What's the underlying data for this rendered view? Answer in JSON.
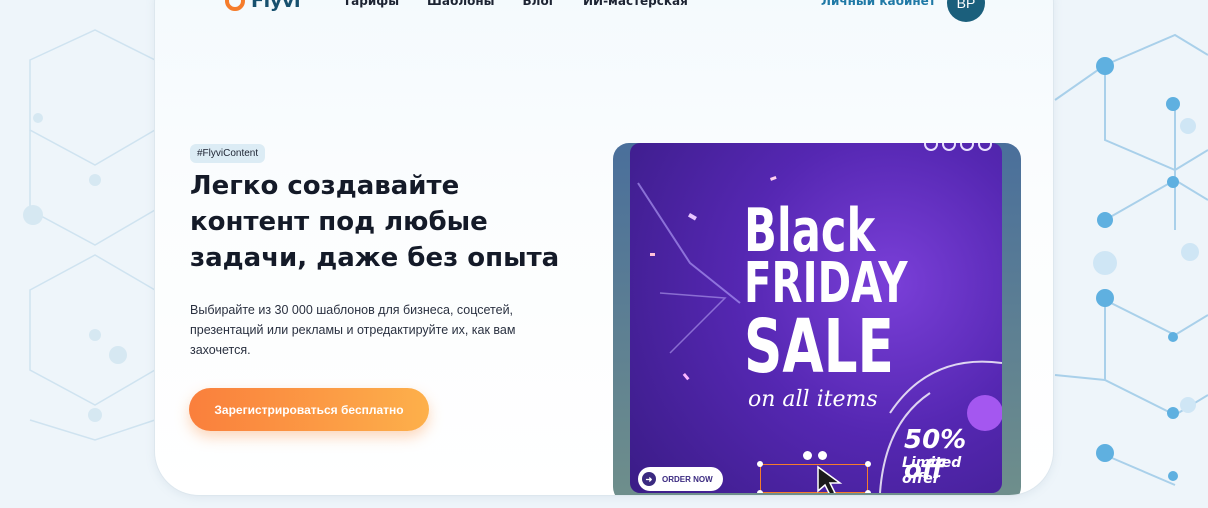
{
  "header": {
    "logo_text": "Flyvi",
    "nav": [
      "Тарифы",
      "Шаблоны",
      "Блог",
      "ИИ-мастерская"
    ],
    "account_link": "Личный кабинет",
    "avatar_initials": "BP"
  },
  "hero": {
    "tag": "#FlyviContent",
    "title_lines": [
      "Легко создавайте",
      "контент под любые",
      "задачи, даже без опыта"
    ],
    "description_lines": [
      "Выбирайте из 30 000 шаблонов для бизнеса, соцсетей,",
      "презентаций или рекламы и отредактируйте их, как вам",
      "захочется."
    ],
    "cta": "Зарегистрироваться бесплатно"
  },
  "preview": {
    "line1": "Black",
    "line2": "FRIDAY",
    "line3": "SALE",
    "script": "on all items",
    "offer_big": "50% off",
    "offer_small": "Limited offer",
    "order_button": "ORDER NOW"
  },
  "colors": {
    "brand_orange": "#f57c2b",
    "brand_blue": "#17506e",
    "link_blue": "#1f79a6",
    "cta_gradient": [
      "#fa7f3c",
      "#fdb04b"
    ],
    "poster_purple": "#5527b2"
  }
}
